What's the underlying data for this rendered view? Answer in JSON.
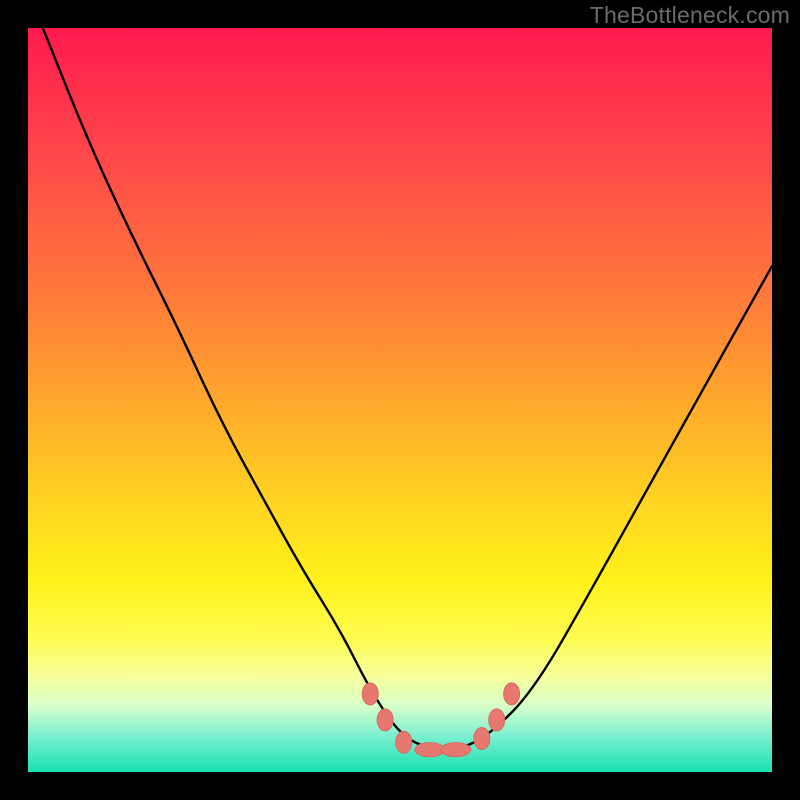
{
  "watermark": "TheBottleneck.com",
  "colors": {
    "frame": "#000000",
    "curve_stroke": "#000000",
    "marker_fill": "#e6786f",
    "marker_stroke": "#d86a60",
    "gradient_stops": [
      "#ff1a4d",
      "#ff4a4a",
      "#ff7a3a",
      "#ffae2a",
      "#ffd522",
      "#fff11a",
      "#fffc50",
      "#f7ff9a",
      "#d8ffc8",
      "#7ff0d2",
      "#18e0b0"
    ]
  },
  "chart_data": {
    "type": "line",
    "title": "",
    "xlabel": "",
    "ylabel": "",
    "xlim": [
      0,
      100
    ],
    "ylim": [
      0,
      100
    ],
    "grid": false,
    "legend": false,
    "note": "Bottleneck-style curve. x/y in percent of plot area (0,0 = bottom-left). Values estimated from pixels.",
    "series": [
      {
        "name": "curve",
        "x": [
          2,
          8,
          14,
          20,
          26,
          32,
          37,
          42,
          46,
          50,
          54,
          58,
          62,
          68,
          76,
          86,
          100
        ],
        "y": [
          100,
          85,
          72,
          60,
          47,
          36,
          27,
          19,
          11,
          5,
          3,
          3,
          5,
          11,
          25,
          43,
          68
        ]
      }
    ],
    "markers": {
      "name": "highlight-points",
      "x": [
        46,
        48,
        50.5,
        54,
        57.5,
        61,
        63,
        65
      ],
      "y": [
        10.5,
        7,
        4,
        3,
        3,
        4.5,
        7,
        10.5
      ]
    }
  }
}
